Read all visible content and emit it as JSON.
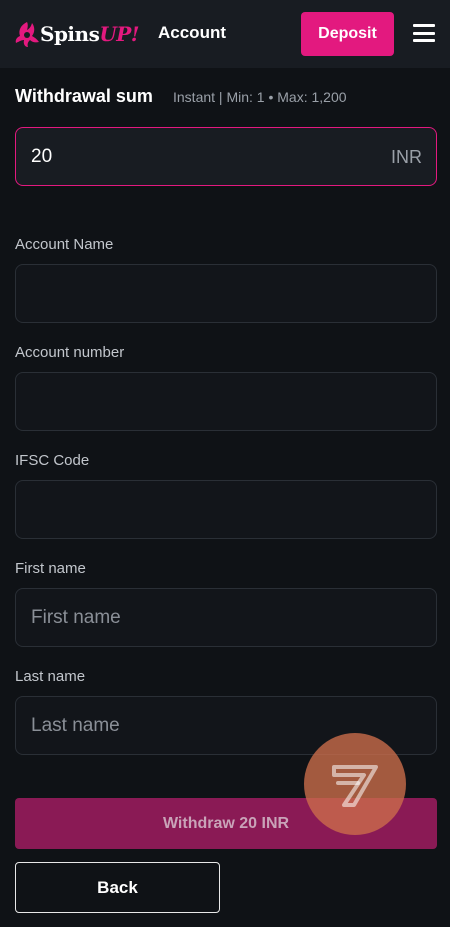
{
  "header": {
    "logo": {
      "word": "Spins",
      "accent": "UP!"
    },
    "nav_label": "Account",
    "deposit_label": "Deposit",
    "menu_icon": "hamburger-icon"
  },
  "withdrawal": {
    "title": "Withdrawal sum",
    "hint": "Instant | Min: 1 • Max: 1,200",
    "amount": "20",
    "currency": "INR"
  },
  "fields": {
    "account_name": {
      "label": "Account Name",
      "value": "",
      "placeholder": ""
    },
    "account_number": {
      "label": "Account number",
      "value": "",
      "placeholder": ""
    },
    "ifsc": {
      "label": "IFSC Code",
      "value": "",
      "placeholder": ""
    },
    "first_name": {
      "label": "First name",
      "value": "",
      "placeholder": "First name"
    },
    "last_name": {
      "label": "Last name",
      "value": "",
      "placeholder": "Last name"
    }
  },
  "actions": {
    "withdraw_label": "Withdraw 20 INR",
    "back_label": "Back"
  },
  "widget": {
    "icon": "chat-support-icon"
  },
  "colors": {
    "accent": "#e3197f",
    "background": "#0f1216",
    "header": "#181c22",
    "withdraw_disabled": "#8a1a55",
    "widget": "#cd6e4b"
  }
}
